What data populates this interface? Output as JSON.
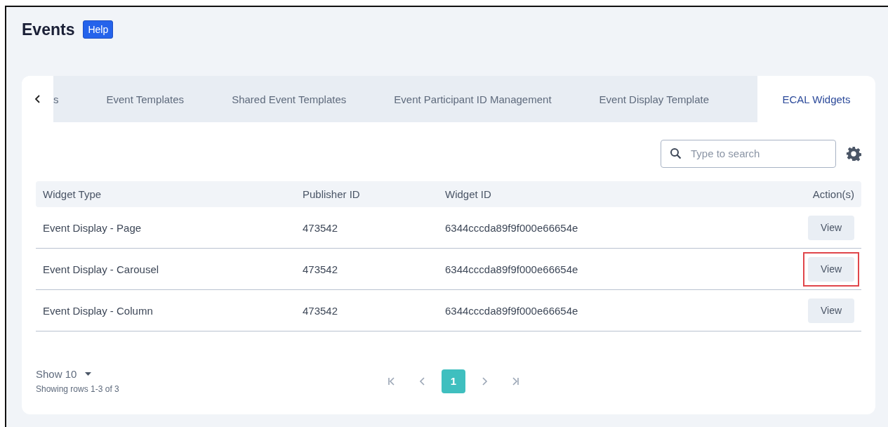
{
  "page": {
    "title": "Events",
    "help_button": "Help"
  },
  "tabs": [
    {
      "label": "s",
      "selected": false
    },
    {
      "label": "Event Templates",
      "selected": false
    },
    {
      "label": "Shared Event Templates",
      "selected": false
    },
    {
      "label": "Event Participant ID Management",
      "selected": false
    },
    {
      "label": "Event Display Template",
      "selected": false
    },
    {
      "label": "ECAL Widgets",
      "selected": true
    }
  ],
  "search": {
    "placeholder": "Type to search"
  },
  "table": {
    "columns": [
      "Widget Type",
      "Publisher ID",
      "Widget ID",
      "Action(s)"
    ],
    "rows": [
      {
        "widget_type": "Event Display - Page",
        "publisher_id": "473542",
        "widget_id": "6344cccda89f9f000e66654e",
        "action": "View",
        "highlighted": false
      },
      {
        "widget_type": "Event Display - Carousel",
        "publisher_id": "473542",
        "widget_id": "6344cccda89f9f000e66654e",
        "action": "View",
        "highlighted": true
      },
      {
        "widget_type": "Event Display - Column",
        "publisher_id": "473542",
        "widget_id": "6344cccda89f9f000e66654e",
        "action": "View",
        "highlighted": false
      }
    ]
  },
  "footer": {
    "page_size": "Show 10",
    "summary": "Showing rows 1-3 of 3"
  },
  "pagination": [
    {
      "kind": "first"
    },
    {
      "kind": "prev"
    },
    {
      "kind": "page",
      "label": "1",
      "selected": true
    },
    {
      "kind": "next"
    },
    {
      "kind": "last"
    }
  ]
}
